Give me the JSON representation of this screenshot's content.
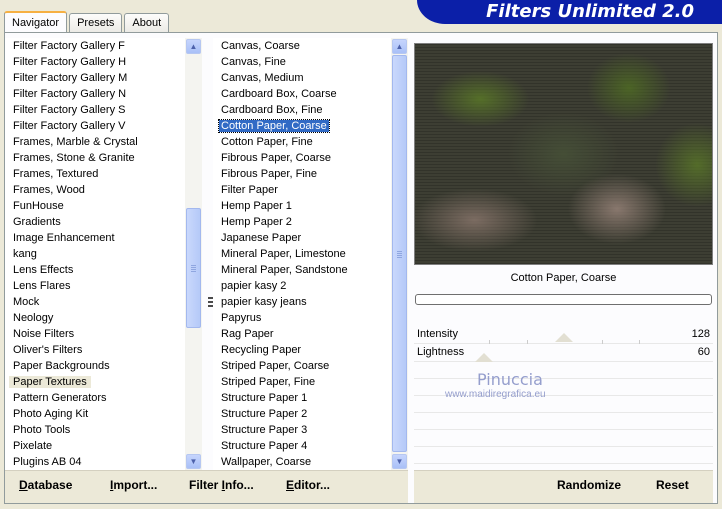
{
  "tabs": [
    {
      "label": "Navigator",
      "active": true
    },
    {
      "label": "Presets",
      "active": false
    },
    {
      "label": "About",
      "active": false
    }
  ],
  "app_title": "Filters Unlimited 2.0",
  "categories": [
    "Filter Factory Gallery F",
    "Filter Factory Gallery H",
    "Filter Factory Gallery M",
    "Filter Factory Gallery N",
    "Filter Factory Gallery S",
    "Filter Factory Gallery V",
    "Frames, Marble & Crystal",
    "Frames, Stone & Granite",
    "Frames, Textured",
    "Frames, Wood",
    "FunHouse",
    "Gradients",
    "Image Enhancement",
    "kang",
    "Lens Effects",
    "Lens Flares",
    "Mock",
    "Neology",
    "Noise Filters",
    "Oliver's Filters",
    "Paper Backgrounds",
    "Paper Textures",
    "Pattern Generators",
    "Photo Aging Kit",
    "Photo Tools",
    "Pixelate",
    "Plugins AB 04"
  ],
  "selected_category": "Paper Textures",
  "filters": [
    "Canvas, Coarse",
    "Canvas, Fine",
    "Canvas, Medium",
    "Cardboard Box, Coarse",
    "Cardboard Box, Fine",
    "Cotton Paper, Coarse",
    "Cotton Paper, Fine",
    "Fibrous Paper, Coarse",
    "Fibrous Paper, Fine",
    "Filter Paper",
    "Hemp Paper 1",
    "Hemp Paper 2",
    "Japanese Paper",
    "Mineral Paper, Limestone",
    "Mineral Paper, Sandstone",
    "papier kasy 2",
    "papier kasy jeans",
    "Papyrus",
    "Rag Paper",
    "Recycling Paper",
    "Striped Paper, Coarse",
    "Striped Paper, Fine",
    "Structure Paper 1",
    "Structure Paper 2",
    "Structure Paper 3",
    "Structure Paper 4",
    "Wallpaper, Coarse"
  ],
  "selected_filter": "Cotton Paper, Coarse",
  "preview": {
    "filter_name": "Cotton Paper, Coarse"
  },
  "params": [
    {
      "label": "Intensity",
      "value": "128",
      "level": 0.5
    },
    {
      "label": "Lightness",
      "value": "60",
      "level": 0.235
    }
  ],
  "watermark": {
    "line1": "Pinuccia",
    "line2": "www.maidiregrafica.eu"
  },
  "buttons": {
    "database": {
      "pre": "D",
      "rest": "atabase"
    },
    "import": {
      "pre": "I",
      "rest": "mport..."
    },
    "filter_info": {
      "pre": "Filter ",
      "ul": "I",
      "rest": "nfo..."
    },
    "editor": {
      "pre": "E",
      "rest": "ditor..."
    },
    "randomize": "Randomize",
    "reset": "Reset"
  },
  "colors": {
    "banner": "#0b1fa8",
    "selection": "#316ac5"
  }
}
